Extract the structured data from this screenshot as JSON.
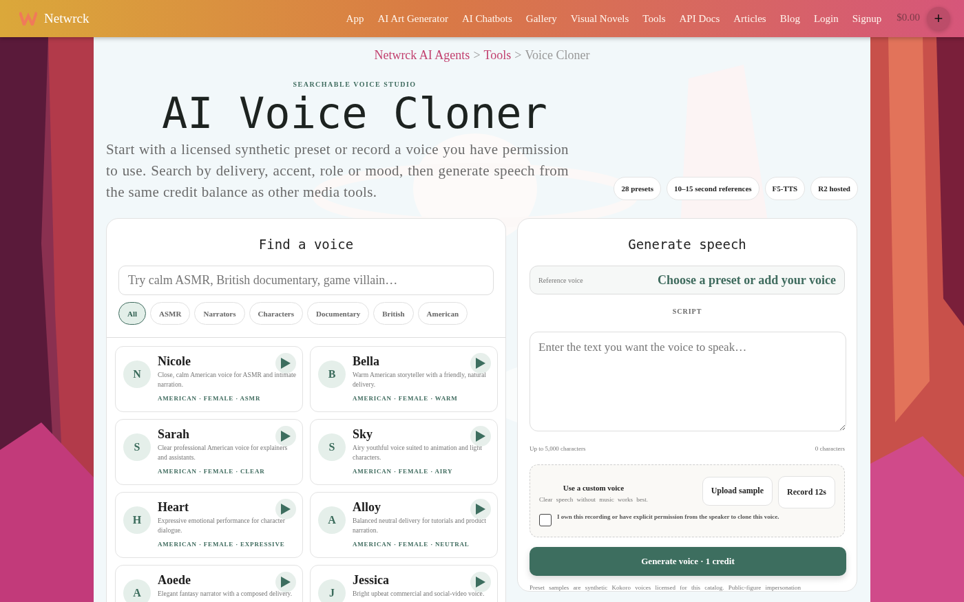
{
  "header": {
    "brand": "Netwrck",
    "nav": [
      "App",
      "AI Art Generator",
      "AI Chatbots",
      "Gallery",
      "Visual Novels",
      "Tools",
      "API Docs",
      "Articles",
      "Blog",
      "Login",
      "Signup"
    ],
    "balance": "$0.00",
    "add_button": "+"
  },
  "breadcrumb": [
    {
      "label": "Netwrck AI Agents",
      "kind": "link"
    },
    {
      "label": ">",
      "kind": "sep"
    },
    {
      "label": "Tools",
      "kind": "link"
    },
    {
      "label": ">",
      "kind": "sep"
    },
    {
      "label": "Voice Cloner",
      "kind": "current"
    }
  ],
  "hero": {
    "eyebrow": "SEARCHABLE VOICE STUDIO",
    "title": "AI Voice Cloner",
    "description": "Start with a licensed synthetic preset or record a voice you have permission to use. Search by delivery, accent, role or mood, then generate speech from the same credit balance as other media tools.",
    "badges": [
      "28 presets",
      "10–15 second references",
      "F5-TTS",
      "R2 hosted"
    ]
  },
  "find_panel": {
    "title": "Find a voice",
    "search": {
      "placeholder": "Try calm ASMR, British documentary, game villain…"
    },
    "filters": [
      {
        "label": "All",
        "selected": true
      },
      {
        "label": "ASMR",
        "selected": false
      },
      {
        "label": "Narrators",
        "selected": false
      },
      {
        "label": "Characters",
        "selected": false
      },
      {
        "label": "Documentary",
        "selected": false
      },
      {
        "label": "British",
        "selected": false
      },
      {
        "label": "American",
        "selected": false
      }
    ],
    "voices": [
      {
        "initial": "N",
        "name": "Nicole",
        "description": "Close, calm American voice for ASMR and intimate narration.",
        "tags": "AMERICAN · FEMALE · ASMR"
      },
      {
        "initial": "B",
        "name": "Bella",
        "description": "Warm American storyteller with a friendly, natural delivery.",
        "tags": "AMERICAN · FEMALE · WARM"
      },
      {
        "initial": "S",
        "name": "Sarah",
        "description": "Clear professional American voice for explainers and assistants.",
        "tags": "AMERICAN · FEMALE · CLEAR"
      },
      {
        "initial": "S",
        "name": "Sky",
        "description": "Airy youthful voice suited to animation and light characters.",
        "tags": "AMERICAN · FEMALE · AIRY"
      },
      {
        "initial": "H",
        "name": "Heart",
        "description": "Expressive emotional performance for character dialogue.",
        "tags": "AMERICAN · FEMALE · EXPRESSIVE"
      },
      {
        "initial": "A",
        "name": "Alloy",
        "description": "Balanced neutral delivery for tutorials and product narration.",
        "tags": "AMERICAN · FEMALE · NEUTRAL"
      },
      {
        "initial": "A",
        "name": "Aoede",
        "description": "Elegant fantasy narrator with a composed delivery."
      },
      {
        "initial": "J",
        "name": "Jessica",
        "description": "Bright upbeat commercial and social-video voice."
      }
    ]
  },
  "generate_panel": {
    "title": "Generate speech",
    "reference": {
      "label": "Reference voice",
      "value": "Choose a preset or add your voice"
    },
    "script_label": "SCRIPT",
    "script": {
      "placeholder": "Enter the text you want the voice to speak…"
    },
    "limit": "Up to 5,000 characters",
    "count": "0 characters",
    "custom": {
      "title": "Use a custom voice",
      "hint": "Clear speech without music works best.",
      "buttons": [
        "Upload sample",
        "Record 12s"
      ],
      "consent": {
        "label": "I own this recording or have explicit permission from the speaker to clone this voice.",
        "checked": false
      }
    },
    "generate_button": "Generate voice · 1 credit",
    "footnote": "Preset samples are synthetic Kokoro voices licensed for this catalog. Public-figure impersonation"
  }
}
